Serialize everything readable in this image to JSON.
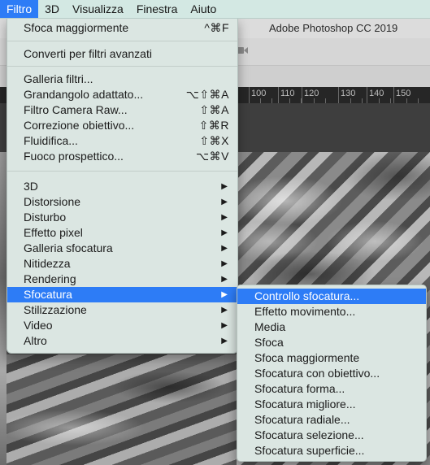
{
  "menubar": {
    "items": [
      "Filtro",
      "3D",
      "Visualizza",
      "Finestra",
      "Aiuto"
    ],
    "active_index": 0
  },
  "app": {
    "title": "Adobe Photoshop CC 2019",
    "ruler_labels": [
      "100",
      "110",
      "120",
      "130",
      "140",
      "150"
    ]
  },
  "filter_menu": {
    "items": [
      {
        "label": "Sfoca maggiormente",
        "shortcut": "^⌘F"
      },
      {
        "label": "Converti per filtri avanzati"
      },
      {
        "label": "Galleria filtri..."
      },
      {
        "label": "Grandangolo adattato...",
        "shortcut": "⌥⇧⌘A"
      },
      {
        "label": "Filtro Camera Raw...",
        "shortcut": "⇧⌘A"
      },
      {
        "label": "Correzione obiettivo...",
        "shortcut": "⇧⌘R"
      },
      {
        "label": "Fluidifica...",
        "shortcut": "⇧⌘X"
      },
      {
        "label": "Fuoco prospettico...",
        "shortcut": "⌥⌘V"
      },
      {
        "label": "3D",
        "arrow": "▶"
      },
      {
        "label": "Distorsione",
        "arrow": "▶"
      },
      {
        "label": "Disturbo",
        "arrow": "▶"
      },
      {
        "label": "Effetto pixel",
        "arrow": "▶"
      },
      {
        "label": "Galleria sfocatura",
        "arrow": "▶"
      },
      {
        "label": "Nitidezza",
        "arrow": "▶"
      },
      {
        "label": "Rendering",
        "arrow": "▶"
      },
      {
        "label": "Sfocatura",
        "arrow": "▶"
      },
      {
        "label": "Stilizzazione",
        "arrow": "▶"
      },
      {
        "label": "Video",
        "arrow": "▶"
      },
      {
        "label": "Altro",
        "arrow": "▶"
      }
    ],
    "highlighted_label": "Sfocatura"
  },
  "blur_submenu": {
    "items": [
      "Controllo sfocatura...",
      "Effetto movimento...",
      "Media",
      "Sfoca",
      "Sfoca maggiormente",
      "Sfocatura con obiettivo...",
      "Sfocatura forma...",
      "Sfocatura migliore...",
      "Sfocatura radiale...",
      "Sfocatura selezione...",
      "Sfocatura superficie..."
    ],
    "highlighted_label": "Controllo sfocatura..."
  },
  "colors": {
    "menubar_bg": "#d3e8e3",
    "menu_bg": "#dbe6e2",
    "highlight": "#2d7cf6"
  }
}
